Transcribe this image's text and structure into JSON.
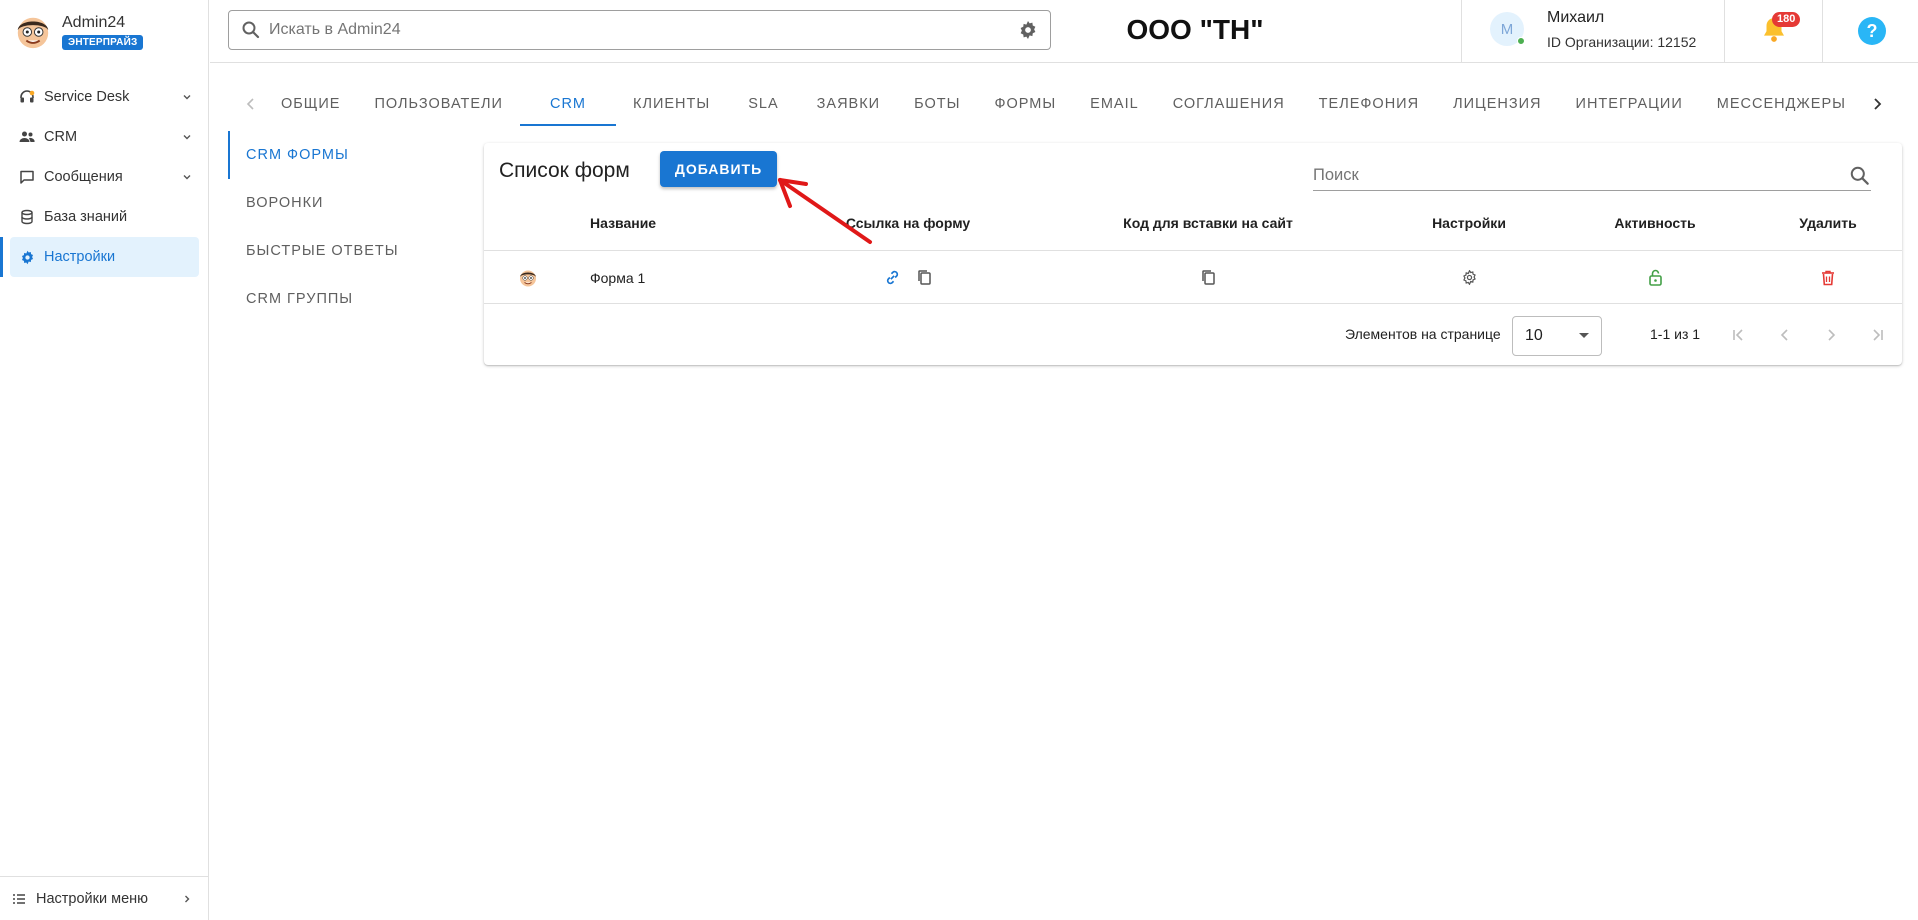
{
  "brand": {
    "name": "Admin24",
    "badge": "ЭНТЕРПРАЙЗ"
  },
  "sidebar": {
    "items": [
      {
        "label": "Service Desk",
        "icon": "headset-icon",
        "expandable": true
      },
      {
        "label": "CRM",
        "icon": "people-icon",
        "expandable": true
      },
      {
        "label": "Сообщения",
        "icon": "chat-icon",
        "expandable": true
      },
      {
        "label": "База знаний",
        "icon": "database-icon",
        "expandable": false
      },
      {
        "label": "Настройки",
        "icon": "gear-icon",
        "expandable": false,
        "active": true
      }
    ],
    "footer": {
      "label": "Настройки меню",
      "icon": "menu-settings-icon"
    }
  },
  "header": {
    "search_placeholder": "Искать в Admin24",
    "org_title": "ООО \"ТН\"",
    "user": {
      "initial": "М",
      "name": "Михаил",
      "org_id": "ID Организации: 12152",
      "status": "online"
    },
    "notifications_count": "180"
  },
  "tabs": {
    "items": [
      "ОБЩИЕ",
      "ПОЛЬЗОВАТЕЛИ",
      "CRM",
      "КЛИЕНТЫ",
      "SLA",
      "ЗАЯВКИ",
      "БОТЫ",
      "ФОРМЫ",
      "EMAIL",
      "СОГЛАШЕНИЯ",
      "ТЕЛЕФОНИЯ",
      "ЛИЦЕНЗИЯ",
      "ИНТЕГРАЦИИ",
      "МЕССЕНДЖЕРЫ"
    ],
    "active": "CRM"
  },
  "subnav": {
    "items": [
      "CRM ФОРМЫ",
      "ВОРОНКИ",
      "БЫСТРЫЕ ОТВЕТЫ",
      "CRM ГРУППЫ"
    ],
    "active": "CRM ФОРМЫ"
  },
  "forms": {
    "title": "Список форм",
    "add_label": "ДОБАВИТЬ",
    "search_placeholder": "Поиск",
    "columns": {
      "name": "Название",
      "link": "Ссылка на форму",
      "embed": "Код для вставки на сайт",
      "settings": "Настройки",
      "active": "Активность",
      "delete": "Удалить"
    },
    "rows": [
      {
        "name": "Форма 1",
        "active": true
      }
    ],
    "pagination": {
      "per_page_label": "Элементов на странице",
      "per_page": "10",
      "range": "1-1 из 1"
    }
  },
  "colors": {
    "accent": "#1976d2",
    "active_green": "#4caf50",
    "delete_red": "#e53935",
    "badge_red": "#e53935",
    "bell_yellow": "#fbc02d",
    "help_blue": "#29b6f6",
    "annotation_red": "#e01818"
  }
}
